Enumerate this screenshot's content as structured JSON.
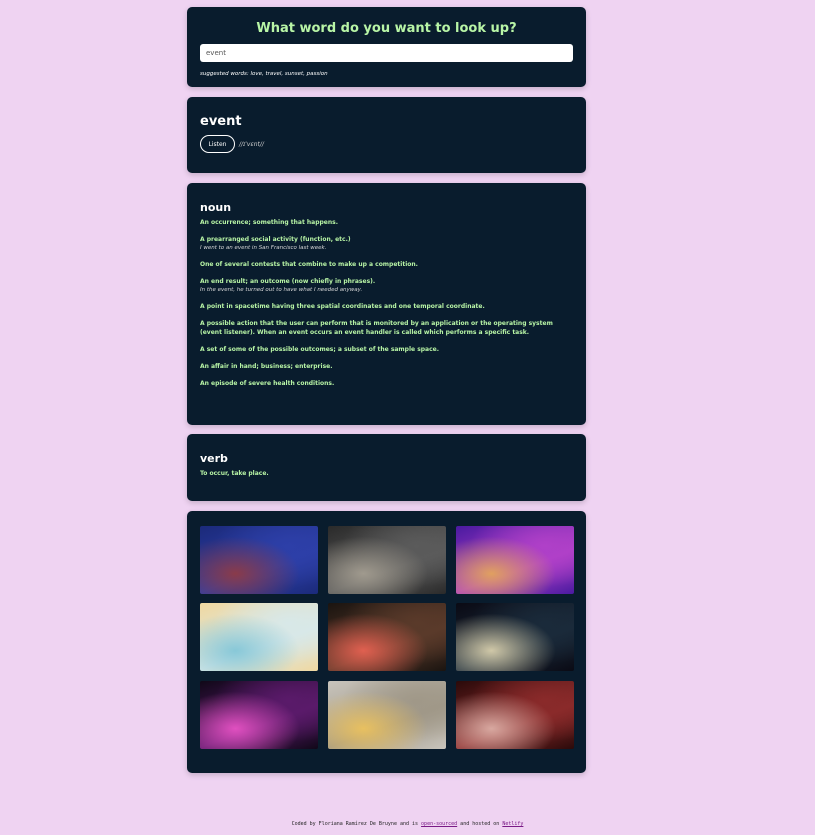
{
  "search": {
    "title": "What word do you want to look up?",
    "value": "event",
    "suggestions": "suggested words: love, travel, sunset, passion"
  },
  "word": {
    "title": "event",
    "listen_label": "Listen",
    "phonetic": "//ɪˈvɛnt//"
  },
  "meanings": [
    {
      "part_of_speech": "noun",
      "definitions": [
        {
          "definition": "An occurrence; something that happens.",
          "example": ""
        },
        {
          "definition": "A prearranged social activity (function, etc.)",
          "example": "I went to an event in San Francisco last week."
        },
        {
          "definition": "One of several contests that combine to make up a competition.",
          "example": ""
        },
        {
          "definition": "An end result; an outcome (now chiefly in phrases).",
          "example": "In the event, he turned out to have what I needed anyway."
        },
        {
          "definition": "A point in spacetime having three spatial coordinates and one temporal coordinate.",
          "example": ""
        },
        {
          "definition": "A possible action that the user can perform that is monitored by an application or the operating system (event listener). When an event occurs an event handler is called which performs a specific task.",
          "example": ""
        },
        {
          "definition": "A set of some of the possible outcomes; a subset of the sample space.",
          "example": ""
        },
        {
          "definition": "An affair in hand; business; enterprise.",
          "example": ""
        },
        {
          "definition": "An episode of severe health conditions.",
          "example": ""
        }
      ]
    },
    {
      "part_of_speech": "verb",
      "definitions": [
        {
          "definition": "To occur, take place.",
          "example": ""
        }
      ]
    }
  ],
  "photos": [
    {
      "name": "photo-audience-blue",
      "colors": [
        "#1b2a7a",
        "#2d3fa8",
        "#8a3b4a"
      ]
    },
    {
      "name": "photo-crowd-concert",
      "colors": [
        "#2a2a2a",
        "#5b5b5b",
        "#a09a8e"
      ]
    },
    {
      "name": "photo-purple-venue",
      "colors": [
        "#4a1aa0",
        "#b040c8",
        "#e0a060"
      ]
    },
    {
      "name": "photo-buffet-food",
      "colors": [
        "#f0d8a0",
        "#d8e8e8",
        "#88c8d8"
      ]
    },
    {
      "name": "photo-party-dance",
      "colors": [
        "#1a1410",
        "#5a3a2a",
        "#e06050"
      ]
    },
    {
      "name": "photo-stage-lights",
      "colors": [
        "#0a0a14",
        "#1a2a3a",
        "#d0c8a8"
      ]
    },
    {
      "name": "photo-pink-stage",
      "colors": [
        "#100818",
        "#5a1a6a",
        "#e050c0"
      ]
    },
    {
      "name": "photo-champagne-glasses",
      "colors": [
        "#c8c4bc",
        "#a09888",
        "#e8c060"
      ]
    },
    {
      "name": "photo-red-auditorium",
      "colors": [
        "#2a0a0a",
        "#8a2a2a",
        "#d8a8a0"
      ]
    }
  ],
  "footer": {
    "text_before": "Coded by Floriana Ramírez De Bruyne and is ",
    "link_open_source": "open-sourced",
    "text_middle": " and hosted on ",
    "link_netlify": "Netlify"
  }
}
